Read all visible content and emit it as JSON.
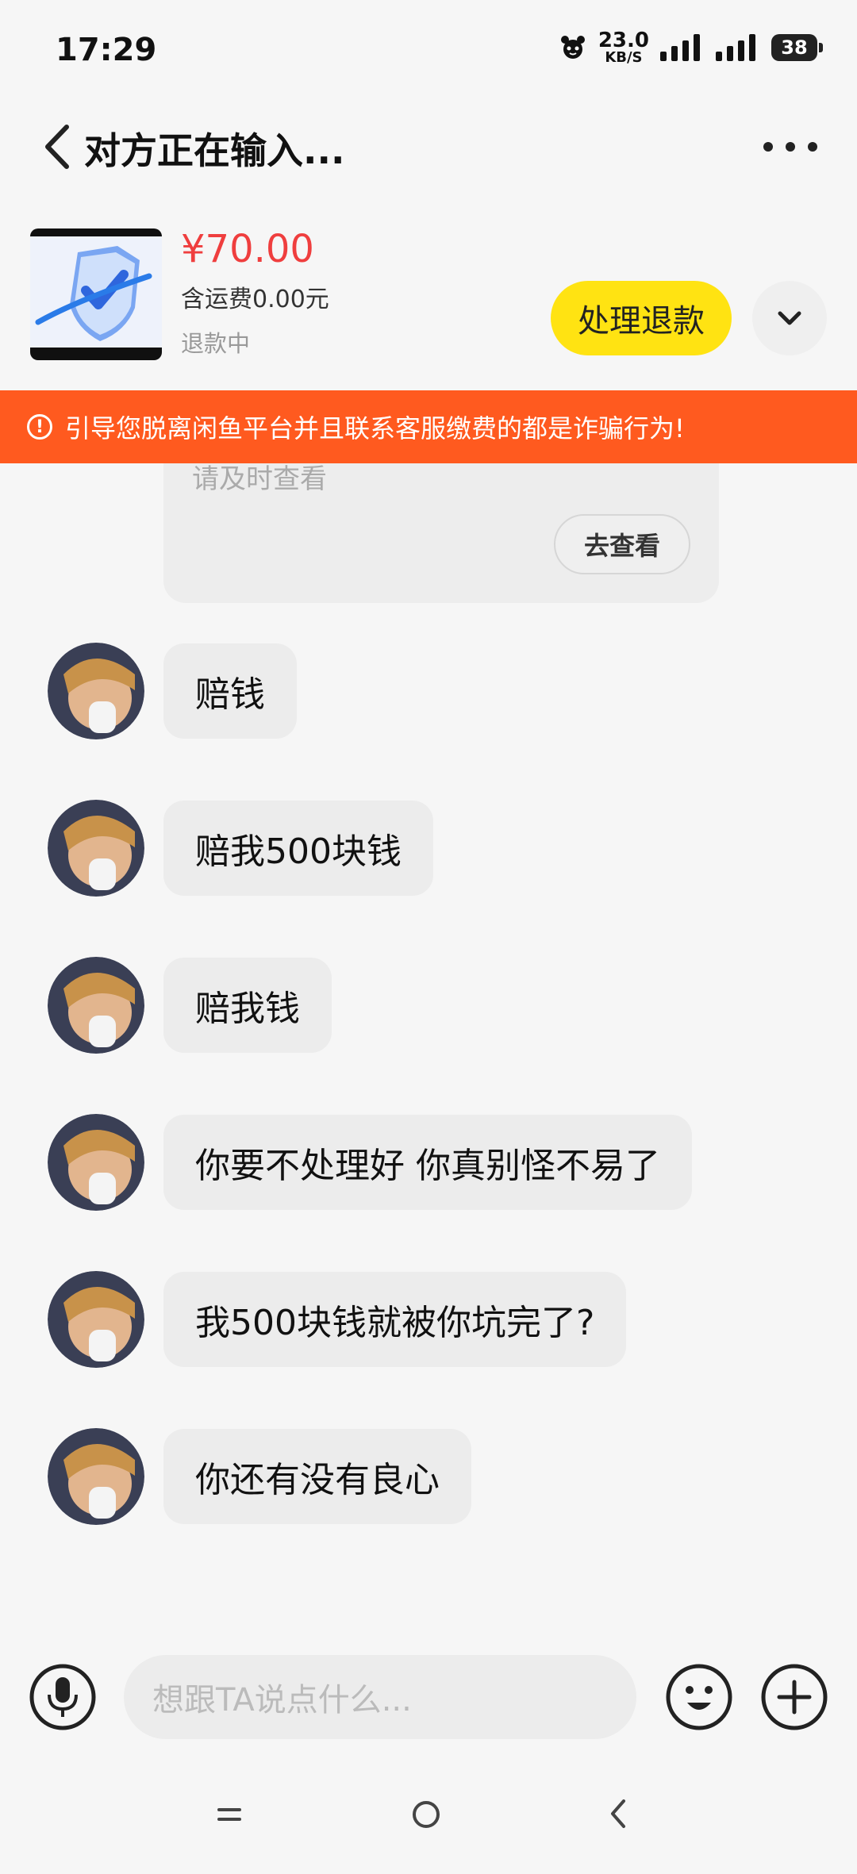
{
  "status_bar": {
    "time": "17:29",
    "net_speed_value": "23.0",
    "net_speed_unit": "KB/S",
    "battery": "38"
  },
  "header": {
    "title": "对方正在输入..."
  },
  "product": {
    "price": "¥70.00",
    "shipping": "含运费0.00元",
    "status": "退款中",
    "action_label": "处理退款"
  },
  "warning": {
    "text": "引导您脱离闲鱼平台并且联系客服缴费的都是诈骗行为!"
  },
  "system_card": {
    "text": "请及时查看",
    "button_label": "去查看"
  },
  "messages": [
    {
      "text": "赔钱"
    },
    {
      "text": "赔我500块钱"
    },
    {
      "text": "赔我钱"
    },
    {
      "text": "你要不处理好 你真别怪不易了"
    },
    {
      "text": "我500块钱就被你坑完了?"
    },
    {
      "text": "你还有没有良心"
    }
  ],
  "input_bar": {
    "placeholder": "想跟TA说点什么..."
  },
  "icons": {
    "back": "back-chevron-icon",
    "more": "more-dots-icon",
    "expand": "chevron-down-icon",
    "warning": "info-circle-icon",
    "mic": "microphone-icon",
    "emoji": "emoji-icon",
    "plus": "plus-icon"
  },
  "colors": {
    "price": "#ef3e3e",
    "refund_button": "#ffe312",
    "warning_banner": "#ff5a1f"
  }
}
